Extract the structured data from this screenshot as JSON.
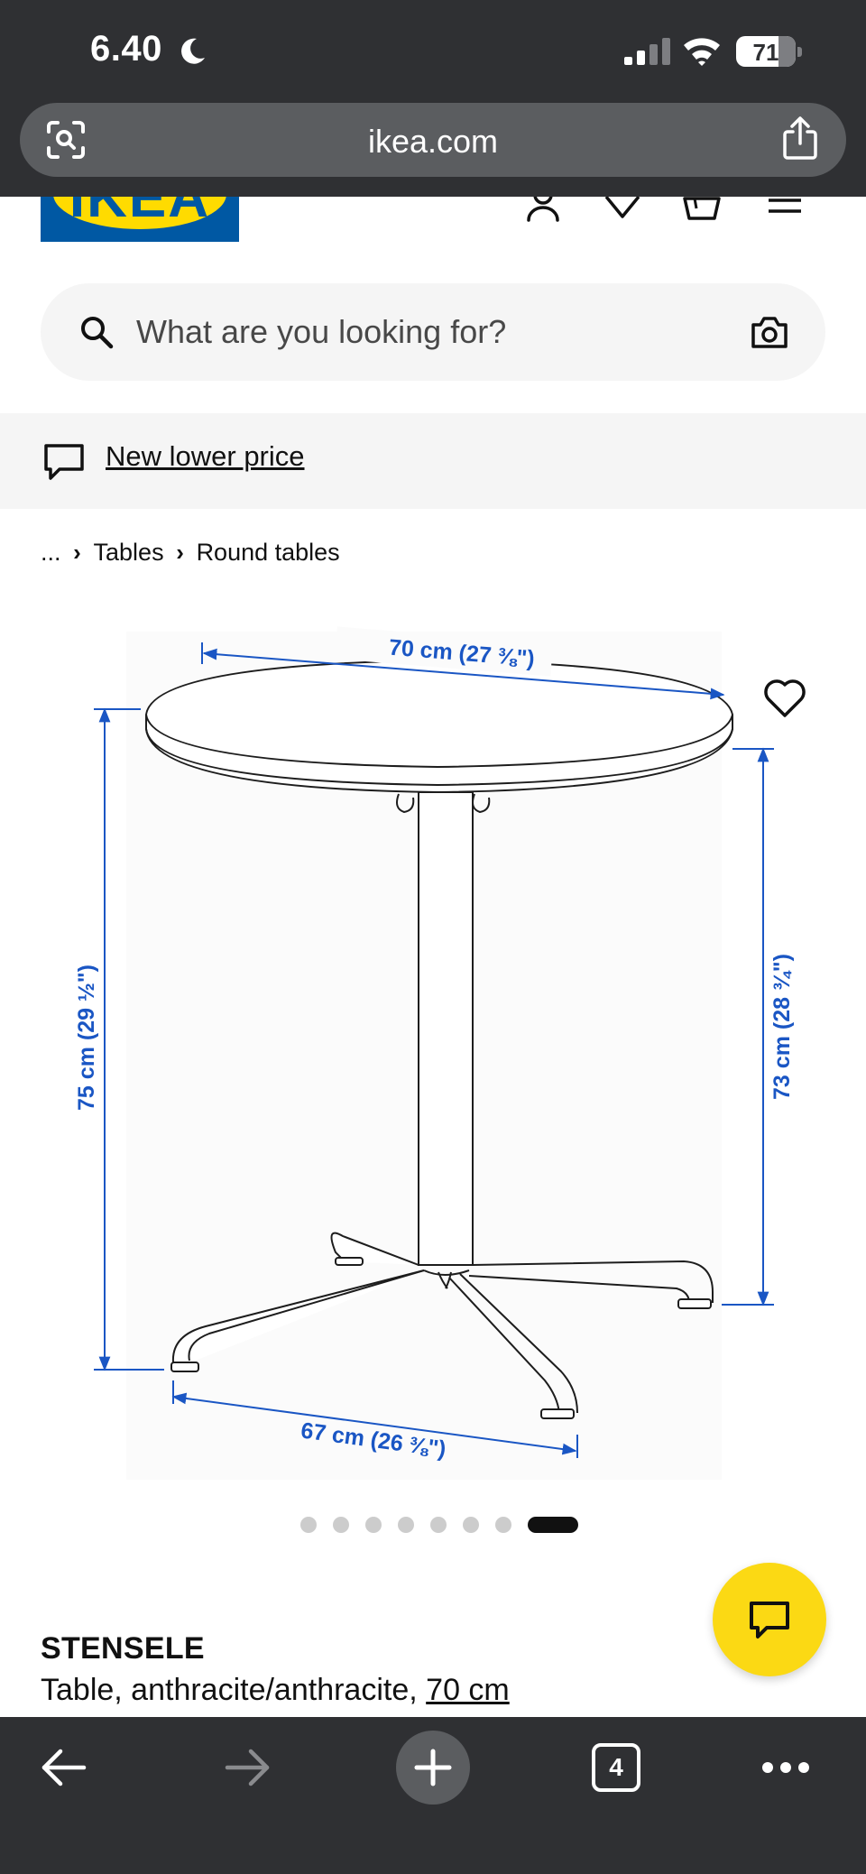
{
  "status_bar": {
    "time": "6.40",
    "battery": "71",
    "battery_level_percent": 71
  },
  "browser": {
    "url": "ikea.com",
    "tab_count": "4"
  },
  "header": {
    "logo_text": "IKEA",
    "icons": [
      "profile-icon",
      "heart-icon",
      "shopping-bag-icon",
      "menu-icon"
    ]
  },
  "search": {
    "placeholder": "What are you looking for?"
  },
  "promo": {
    "label": "New lower price"
  },
  "breadcrumb": {
    "ellipsis": "...",
    "items": [
      "Tables",
      "Round tables"
    ]
  },
  "product_image": {
    "dimensions": {
      "top_diameter": "70 cm (27 ⅜\")",
      "total_height": "75 cm (29 ½\")",
      "height_to_top": "73 cm (28 ¾\")",
      "base_width": "67 cm (26 ⅜\")"
    },
    "slide_count": 8,
    "active_slide": 8
  },
  "product": {
    "name": "STENSELE",
    "description": "Table, anthracite/anthracite, ",
    "size": "70 cm"
  },
  "colors": {
    "ikea_blue": "#0058a3",
    "ikea_yellow": "#ffdb00",
    "dimension_blue": "#1a56c4",
    "chat_yellow": "#fbd914",
    "browser_chrome": "#2f3033"
  }
}
